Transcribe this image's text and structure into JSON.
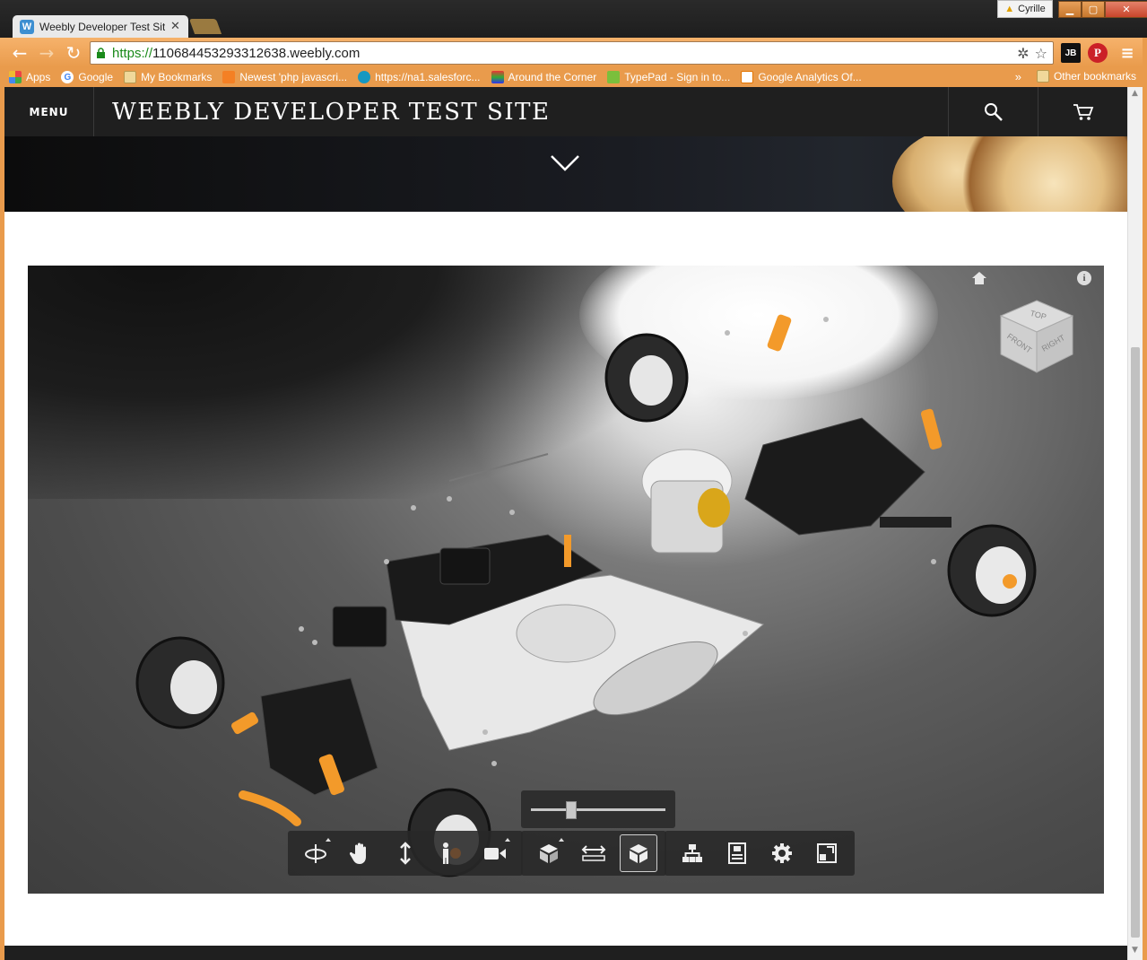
{
  "browser": {
    "tab": {
      "title": "Weebly Developer Test Site",
      "favicon": "W"
    },
    "user": "Cyrille",
    "url": {
      "scheme": "https://",
      "host": "110684453293312638.weebly.com"
    },
    "extensions": {
      "jetbrains": "JB",
      "pinterest": "P"
    },
    "bookmarks": [
      {
        "label": "Apps",
        "icon": "apps-icon"
      },
      {
        "label": "Google",
        "icon": "google-icon"
      },
      {
        "label": "My Bookmarks",
        "icon": "folder-icon"
      },
      {
        "label": "Newest 'php javascri...",
        "icon": "stackoverflow-icon"
      },
      {
        "label": "https://na1.salesforc...",
        "icon": "salesforce-icon"
      },
      {
        "label": "Around the Corner",
        "icon": "site-icon"
      },
      {
        "label": "TypePad - Sign in to...",
        "icon": "typepad-icon"
      },
      {
        "label": "Google Analytics Of...",
        "icon": "analytics-icon"
      }
    ],
    "more_bookmarks": "»",
    "other_bookmarks": "Other bookmarks",
    "accent": "#e99b4c"
  },
  "site": {
    "menu_label": "MENU",
    "title": "WEEBLY DEVELOPER TEST SITE"
  },
  "viewer": {
    "viewcube": {
      "top": "TOP",
      "front": "FRONT",
      "right": "RIGHT"
    },
    "zoom_level": 0.3,
    "tool_groups": [
      [
        "orbit-icon",
        "pan-icon",
        "zoom-icon",
        "first-person-icon",
        "camera-icon"
      ],
      [
        "explode-icon",
        "measure-icon",
        "section-icon"
      ],
      [
        "model-structure-icon",
        "properties-icon",
        "settings-icon",
        "fullscreen-icon"
      ]
    ],
    "info": "i"
  }
}
